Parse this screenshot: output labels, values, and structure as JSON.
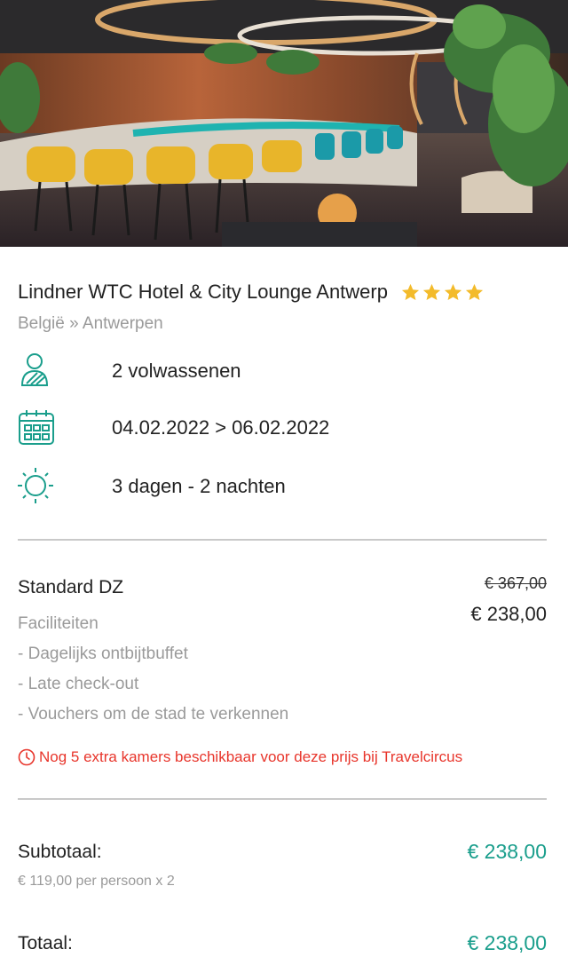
{
  "colors": {
    "accent": "#1a9e8c",
    "star": "#f3bb2b",
    "warning": "#e8352b",
    "muted": "#9a9a9a",
    "divider": "#c9c9c9"
  },
  "hero": {
    "alt_icon": "hotel-lounge-photo"
  },
  "hotel": {
    "name": "Lindner WTC Hotel & City Lounge Antwerp",
    "stars": 4,
    "location": "België » Antwerpen"
  },
  "details": {
    "guests": {
      "icon": "person-icon",
      "text": "2 volwassenen"
    },
    "dates": {
      "icon": "calendar-icon",
      "text": "04.02.2022 > 06.02.2022"
    },
    "duration": {
      "icon": "sun-icon",
      "text": "3 dagen - 2 nachten"
    }
  },
  "room": {
    "name": "Standard DZ",
    "old_price": "€ 367,00",
    "price": "€ 238,00",
    "facilities_heading": "Faciliteiten",
    "facilities": [
      "- Dagelijks ontbijtbuffet",
      "- Late check-out",
      "- Vouchers om de stad te verkennen"
    ]
  },
  "availability": {
    "icon": "clock-icon",
    "text": "Nog 5 extra kamers beschikbaar voor deze prijs bij Travelcircus"
  },
  "summary": {
    "subtotal_label": "Subtotaal:",
    "subtotal_value": "€ 238,00",
    "per_person": "€ 119,00 per persoon x 2",
    "total_label": "Totaal:",
    "total_value": "€ 238,00"
  }
}
